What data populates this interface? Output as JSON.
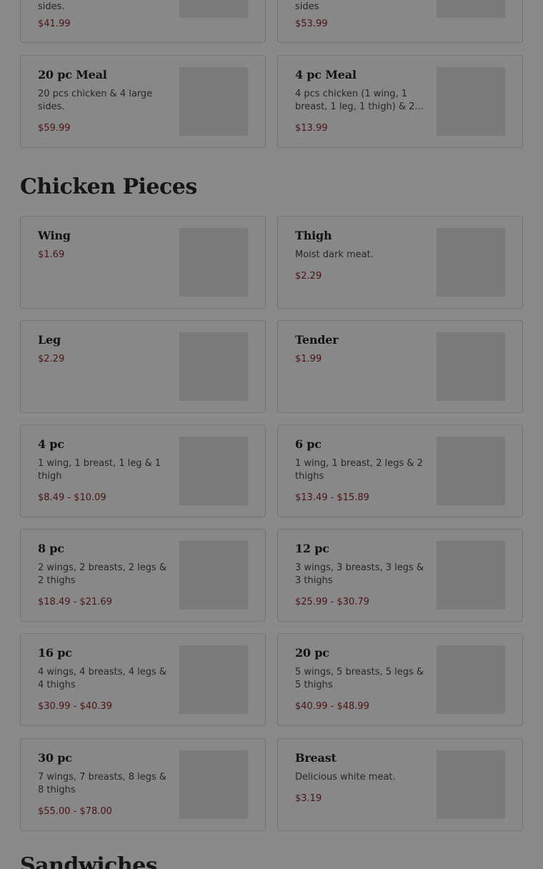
{
  "top_cards": [
    {
      "desc": "sides.",
      "price": "$41.99"
    },
    {
      "desc": "sides",
      "price": "$53.99"
    }
  ],
  "meal_cards": [
    {
      "name": "20 pc Meal",
      "desc": "20 pcs chicken & 4 large sides.",
      "price": "$59.99"
    },
    {
      "name": "4 pc Meal",
      "desc": "4 pcs chicken (1 wing, 1 breast, 1 leg, 1 thigh) & 2...",
      "price": "$13.99"
    }
  ],
  "chicken_section": {
    "title": "Chicken Pieces"
  },
  "chicken_items": [
    {
      "name": "Wing",
      "desc": "",
      "price": "$1.69"
    },
    {
      "name": "Thigh",
      "desc": "Moist dark meat.",
      "price": "$2.29"
    },
    {
      "name": "Leg",
      "desc": "",
      "price": "$2.29"
    },
    {
      "name": "Tender",
      "desc": "",
      "price": "$1.99"
    },
    {
      "name": "4 pc",
      "desc": "1 wing, 1 breast, 1 leg & 1 thigh",
      "price": "$8.49 - $10.09"
    },
    {
      "name": "6 pc",
      "desc": "1 wing, 1 breast, 2 legs & 2 thighs",
      "price": "$13.49 - $15.89"
    },
    {
      "name": "8 pc",
      "desc": "2 wings, 2 breasts, 2 legs & 2 thighs",
      "price": "$18.49 - $21.69"
    },
    {
      "name": "12 pc",
      "desc": "3 wings, 3 breasts, 3 legs & 3 thighs",
      "price": "$25.99 - $30.79"
    },
    {
      "name": "16 pc",
      "desc": "4 wings, 4 breasts, 4 legs & 4 thighs",
      "price": "$30.99 - $40.39"
    },
    {
      "name": "20 pc",
      "desc": "5 wings, 5 breasts, 5 legs & 5 thighs",
      "price": "$40.99 - $48.99"
    },
    {
      "name": "30 pc",
      "desc": "7 wings, 7 breasts, 8 legs & 8 thighs",
      "price": "$55.00 - $78.00"
    },
    {
      "name": "Breast",
      "desc": "Delicious white meat.",
      "price": "$3.19"
    }
  ],
  "next_section": {
    "title": "Sandwiches"
  }
}
